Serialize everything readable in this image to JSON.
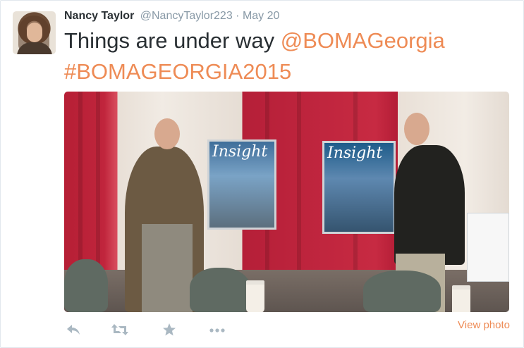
{
  "tweet": {
    "author_name": "Nancy Taylor",
    "author_handle": "@NancyTaylor223",
    "separator": "·",
    "date": "May 20",
    "text_plain": "Things are under way ",
    "mention": "@BOMAGeorgia",
    "hashtag": "#BOMAGEORGIA2015",
    "link_color": "#ee8b55"
  },
  "media": {
    "poster_titles": [
      "Insight",
      "Insight"
    ]
  },
  "actions": {
    "reply_icon": "reply-icon",
    "retweet_icon": "retweet-icon",
    "favorite_icon": "star-icon",
    "more_icon": "more-icon",
    "view_photo_label": "View photo"
  }
}
